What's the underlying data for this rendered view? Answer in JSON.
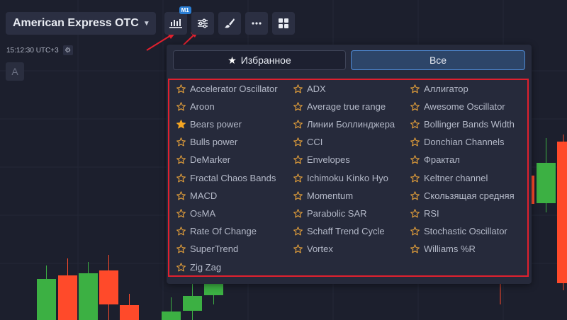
{
  "toolbar": {
    "asset": "American Express OTC",
    "timeframe_badge": "M1"
  },
  "clock": "15:12:30 UTC+3",
  "drawing_badge": "A",
  "indicators_panel": {
    "tabs": [
      {
        "label": "Избранное",
        "icon": "star-icon",
        "active": false
      },
      {
        "label": "Все",
        "active": true
      }
    ],
    "columns": [
      [
        {
          "label": "Accelerator Oscillator",
          "favorite": false
        },
        {
          "label": "Aroon",
          "favorite": false
        },
        {
          "label": "Bears power",
          "favorite": true
        },
        {
          "label": "Bulls power",
          "favorite": false
        },
        {
          "label": "DeMarker",
          "favorite": false
        },
        {
          "label": "Fractal Chaos Bands",
          "favorite": false
        },
        {
          "label": "MACD",
          "favorite": false
        },
        {
          "label": "OsMA",
          "favorite": false
        },
        {
          "label": "Rate Of Change",
          "favorite": false
        },
        {
          "label": "SuperTrend",
          "favorite": false
        },
        {
          "label": "Zig Zag",
          "favorite": false
        }
      ],
      [
        {
          "label": "ADX",
          "favorite": false
        },
        {
          "label": "Average true range",
          "favorite": false
        },
        {
          "label": "Линии Боллинджера",
          "favorite": false
        },
        {
          "label": "CCI",
          "favorite": false
        },
        {
          "label": "Envelopes",
          "favorite": false
        },
        {
          "label": "Ichimoku Kinko Hyo",
          "favorite": false
        },
        {
          "label": "Momentum",
          "favorite": false
        },
        {
          "label": "Parabolic SAR",
          "favorite": false
        },
        {
          "label": "Schaff Trend Cycle",
          "favorite": false
        },
        {
          "label": "Vortex",
          "favorite": false
        }
      ],
      [
        {
          "label": "Аллигатор",
          "favorite": false
        },
        {
          "label": "Awesome Oscillator",
          "favorite": false
        },
        {
          "label": "Bollinger Bands Width",
          "favorite": false
        },
        {
          "label": "Donchian Channels",
          "favorite": false
        },
        {
          "label": "Фрактал",
          "favorite": false
        },
        {
          "label": "Keltner channel",
          "favorite": false
        },
        {
          "label": "Скользящая средняя",
          "favorite": false
        },
        {
          "label": "RSI",
          "favorite": false
        },
        {
          "label": "Stochastic Oscillator",
          "favorite": false
        },
        {
          "label": "Williams %R",
          "favorite": false
        }
      ]
    ]
  },
  "colors": {
    "background": "#1c1f2d",
    "bull": "#3cb043",
    "bear": "#ff4a2a",
    "star_outline": "#e8a23a",
    "star_filled": "#f5a623",
    "highlight_box": "#e0202e",
    "annotation_arrow": "#e0202e",
    "active_tab_border": "#4f8ad4"
  },
  "candles_visible": [
    {
      "dir": "up"
    },
    {
      "dir": "down"
    },
    {
      "dir": "up"
    },
    {
      "dir": "down"
    },
    {
      "dir": "down"
    },
    {
      "dir": "up"
    },
    {
      "dir": "up"
    },
    {
      "dir": "up"
    },
    {
      "dir": "down"
    },
    {
      "dir": "down"
    },
    {
      "dir": "up"
    },
    {
      "dir": "down"
    }
  ]
}
